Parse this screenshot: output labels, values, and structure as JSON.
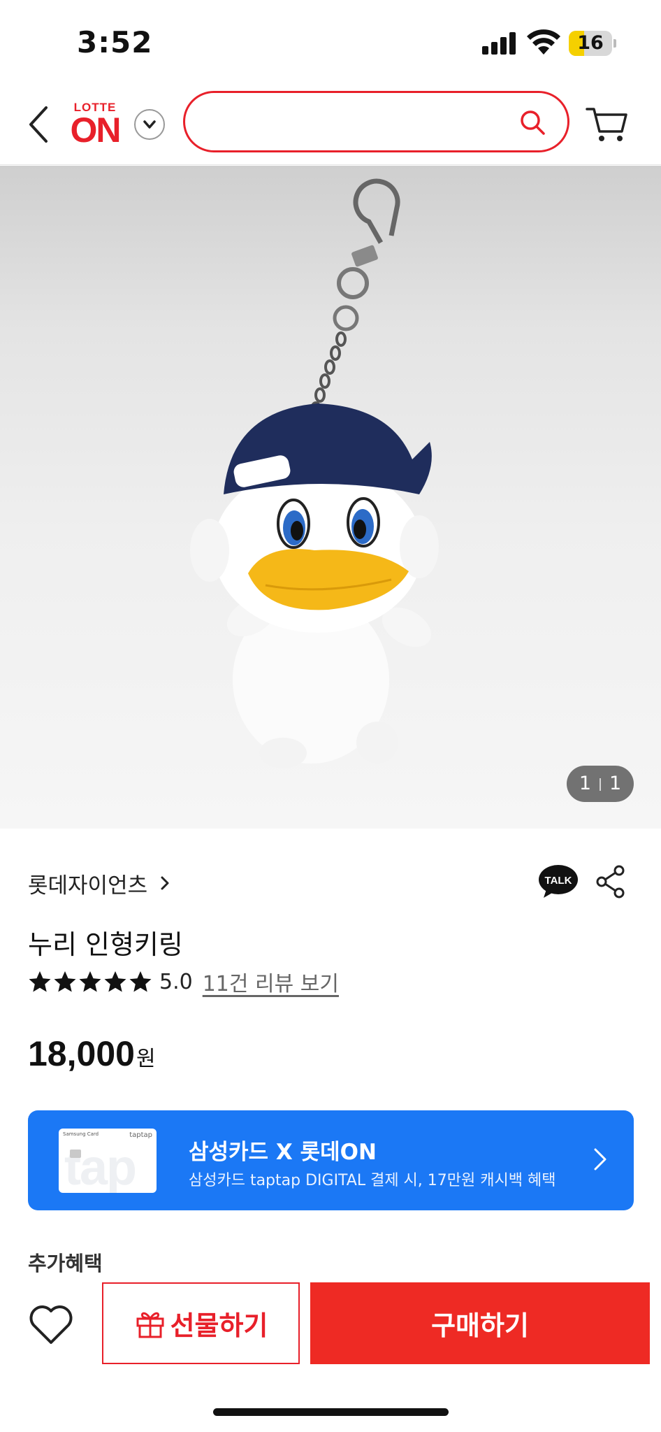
{
  "status_bar": {
    "time": "3:52",
    "battery_level": "16",
    "battery_percent": 16
  },
  "header": {
    "logo_top": "LOTTE",
    "logo_main": "ON",
    "search": {
      "value": "",
      "placeholder": ""
    }
  },
  "product": {
    "image_counter": {
      "current": "1",
      "total": "1"
    },
    "brand": "롯데자이언츠",
    "title": "누리 인형키링",
    "rating": {
      "stars": 5,
      "value": "5.0",
      "review_link": "11건 리뷰 보기"
    },
    "price": {
      "value": "18,000",
      "unit": "원"
    }
  },
  "promo_banner": {
    "card_brand": "Samsung Card",
    "card_logo": "taptap",
    "card_wordmark": "tap",
    "title": "삼성카드 X 롯데ON",
    "subtitle": "삼성카드 taptap DIGITAL 결제 시, 17만원 캐시백 혜택"
  },
  "extra_benefits": {
    "label": "추가혜택"
  },
  "bottom_bar": {
    "gift_label": "선물하기",
    "buy_label": "구매하기"
  },
  "colors": {
    "brand_red": "#e8202a",
    "buy_red": "#ee2a24",
    "banner_blue": "#1b78f5",
    "battery_yellow": "#f5d000"
  },
  "icons": [
    "chevron-left-icon",
    "chevron-down-icon",
    "search-icon",
    "cart-icon",
    "chevron-right-icon",
    "kakao-talk-icon",
    "share-icon",
    "star-icon",
    "heart-icon",
    "gift-icon"
  ]
}
